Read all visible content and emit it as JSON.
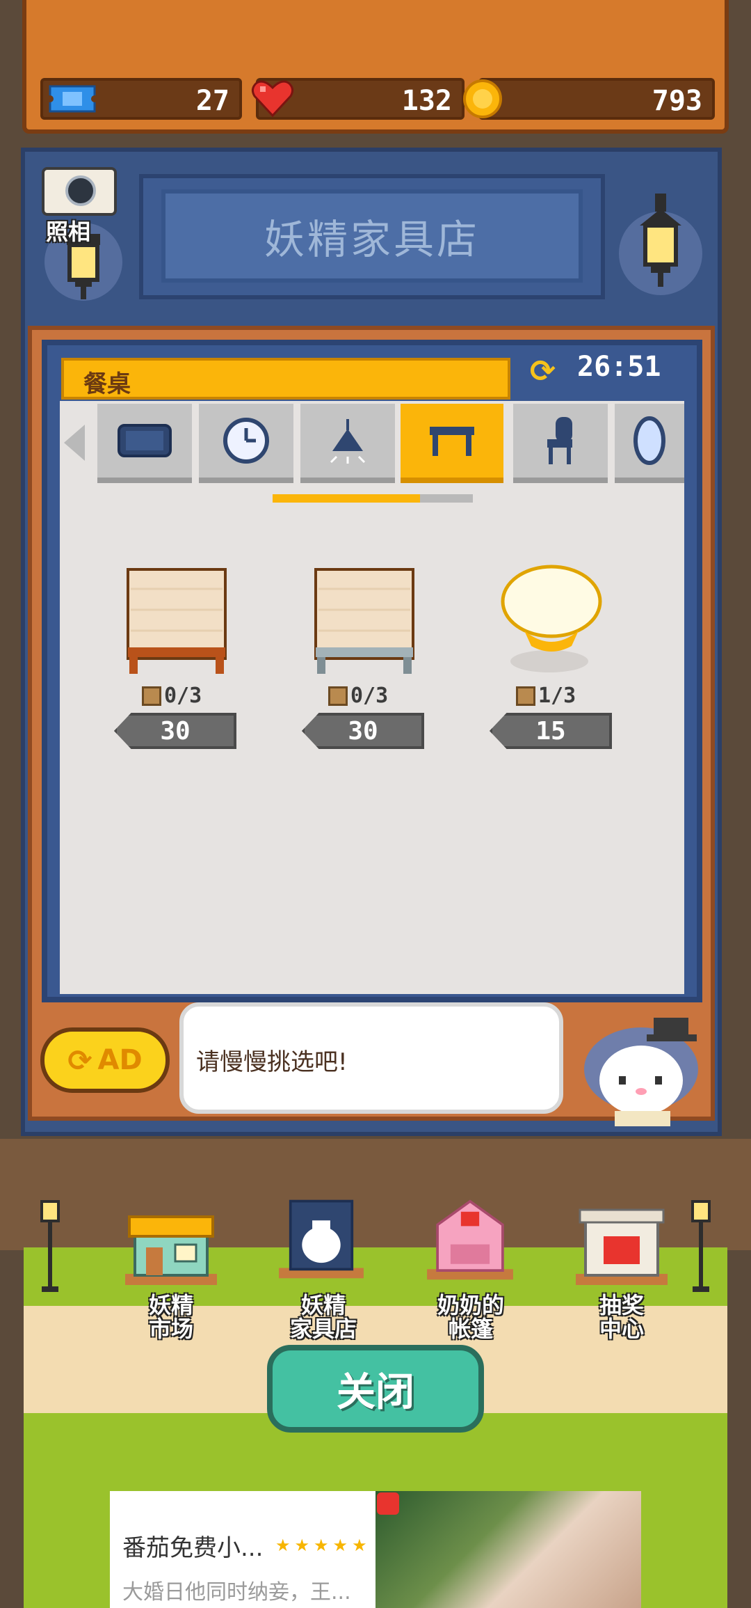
{
  "hud": {
    "tickets": "27",
    "hearts": "132",
    "coins": "793"
  },
  "header": {
    "shop_title": "妖精家具店",
    "camera_label": "照相"
  },
  "shop": {
    "category_label": "餐桌",
    "timer": "26:51",
    "tabs": [
      "rug-icon",
      "clock-icon",
      "lamp-icon",
      "table-icon",
      "chair-icon",
      "mirror-icon"
    ],
    "selected_tab": 3,
    "items": [
      {
        "stock": "0/3",
        "price": "30"
      },
      {
        "stock": "0/3",
        "price": "30"
      },
      {
        "stock": "1/3",
        "price": "15"
      }
    ]
  },
  "dialog": {
    "ad_label": "AD",
    "message": "请慢慢挑选吧!"
  },
  "buildings": [
    {
      "line1": "妖精",
      "line2": "市场"
    },
    {
      "line1": "妖精",
      "line2": "家具店"
    },
    {
      "line1": "奶奶的",
      "line2": "帐篷"
    },
    {
      "line1": "抽奖",
      "line2": "中心"
    }
  ],
  "close_label": "关闭",
  "ad": {
    "title": "番茄免费小...",
    "description": "大婚日他同时纳妾，王...",
    "stars": "★★★★★"
  },
  "colors": {
    "accent": "#fbb50a",
    "frame": "#3a5890",
    "close": "#44c1a2"
  }
}
